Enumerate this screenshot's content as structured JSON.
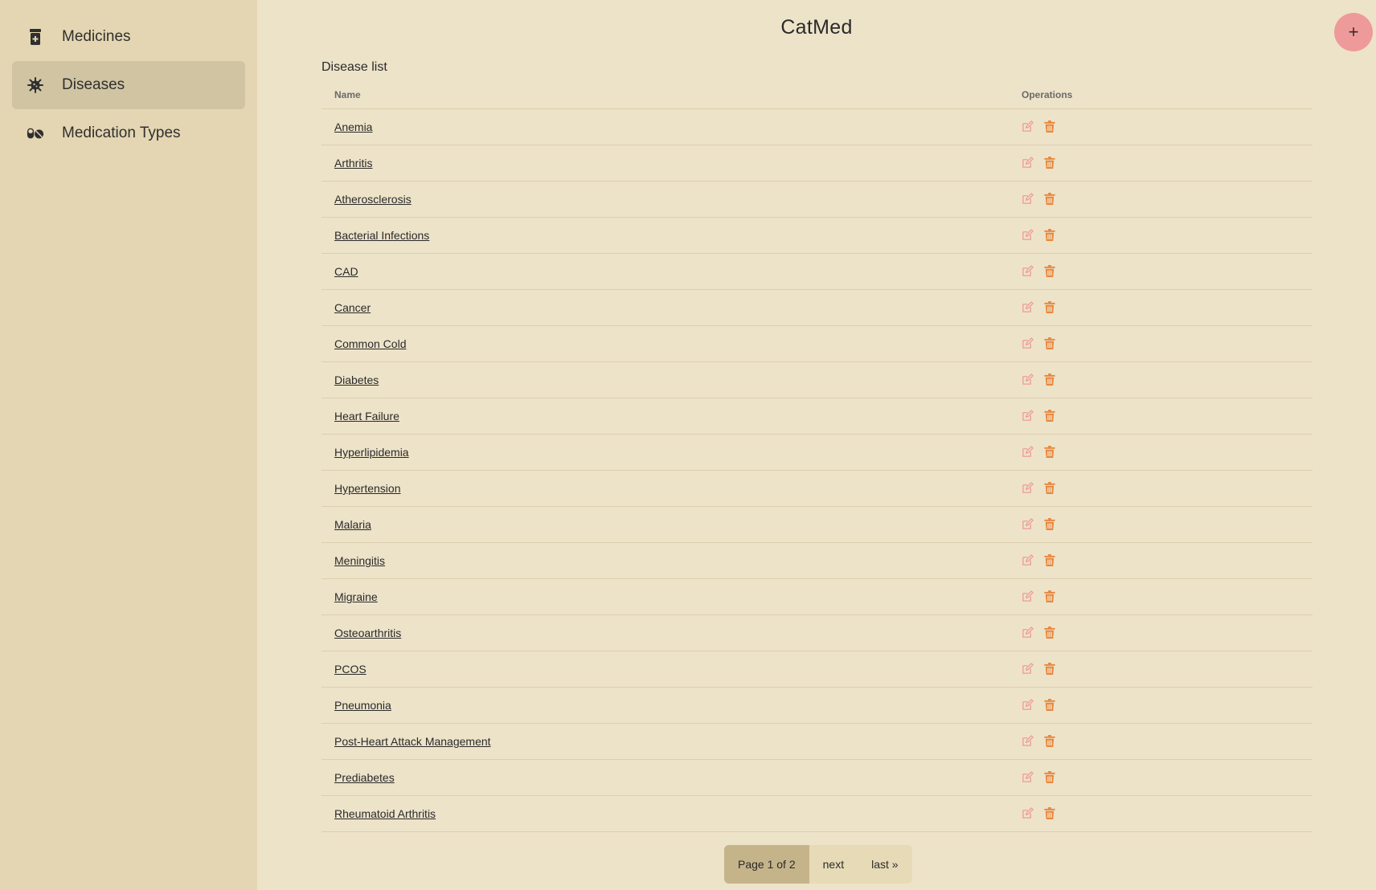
{
  "sidebar": {
    "items": [
      {
        "label": "Medicines",
        "icon": "prescription-bottle-icon",
        "active": false
      },
      {
        "label": "Diseases",
        "icon": "virus-icon",
        "active": true
      },
      {
        "label": "Medication Types",
        "icon": "pills-icon",
        "active": false
      }
    ]
  },
  "header": {
    "title": "CatMed",
    "add_button_label": "+"
  },
  "list": {
    "title": "Disease list",
    "columns": {
      "name": "Name",
      "operations": "Operations"
    },
    "rows": [
      "Anemia",
      "Arthritis",
      "Atherosclerosis",
      "Bacterial Infections",
      "CAD",
      "Cancer",
      "Common Cold",
      "Diabetes",
      "Heart Failure",
      "Hyperlipidemia",
      "Hypertension",
      "Malaria",
      "Meningitis",
      "Migraine",
      "Osteoarthritis",
      "PCOS",
      "Pneumonia",
      "Post-Heart Attack Management",
      "Prediabetes",
      "Rheumatoid Arthritis"
    ],
    "operation_icons": {
      "edit": "edit-icon",
      "delete": "trash-icon"
    }
  },
  "pagination": {
    "current": "Page 1 of 2",
    "next": "next",
    "last": "last »"
  },
  "colors": {
    "background": "#ede3c9",
    "sidebar": "#e4d6b2",
    "sidebar_active": "#d1c4a3",
    "fab": "#ef9a9a",
    "edit_icon": "#ef9a9a",
    "delete_icon": "#e8843a",
    "pagination_current": "#c5b48a"
  }
}
